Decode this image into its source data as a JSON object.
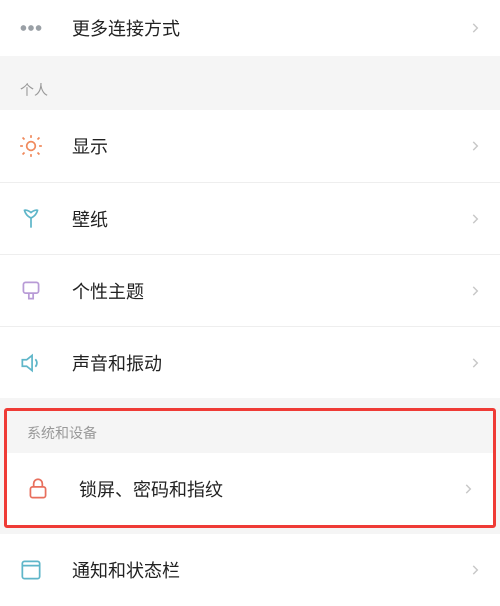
{
  "top": {
    "more_connections": "更多连接方式"
  },
  "sections": {
    "personal": {
      "title": "个人",
      "items": {
        "display": "显示",
        "wallpaper": "壁纸",
        "theme": "个性主题",
        "sound": "声音和振动"
      }
    },
    "system": {
      "title": "系统和设备",
      "items": {
        "lock": "锁屏、密码和指纹",
        "notification": "通知和状态栏"
      }
    }
  }
}
